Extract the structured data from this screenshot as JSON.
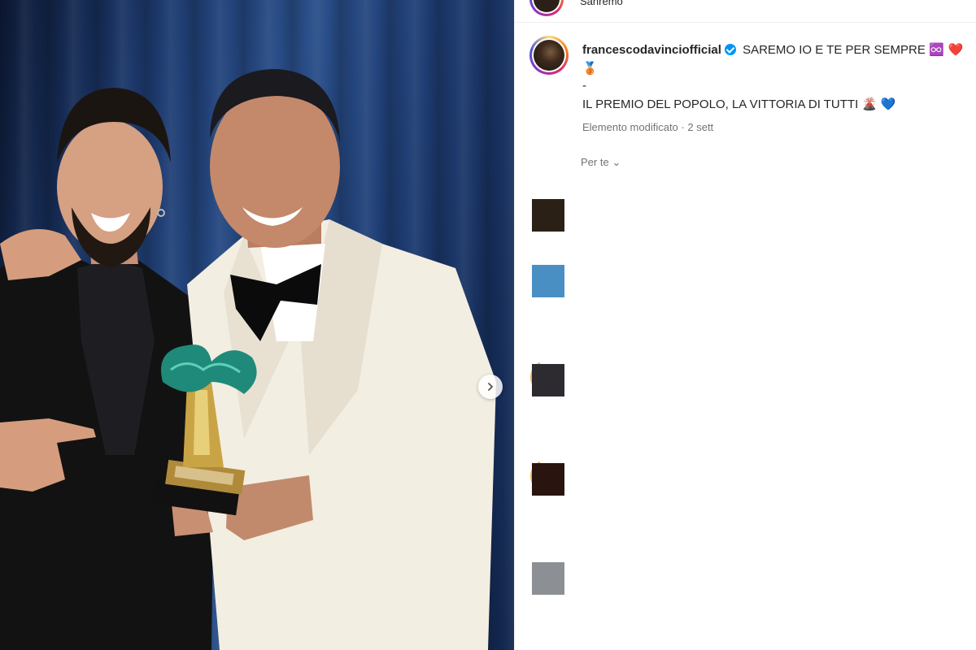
{
  "header": {
    "location": "Sanremo"
  },
  "post": {
    "username": "francescodavinciofficial",
    "caption_line1": "SAREMO IO E TE PER SEMPRE",
    "caption_line1_emojis": "♾️ ❤️",
    "caption_line2_emoji": "🥉",
    "caption_line3": "-",
    "caption_line4": "IL PREMIO DEL POPOLO, LA VITTORIA DI TUTTI",
    "caption_line4_emojis": "🌋 💙",
    "edited_label": "Elemento modificato",
    "time_ago": "2 sett",
    "translate_label": "Per te"
  },
  "colors": {
    "verified": "#0095f6",
    "meta_gray": "#737373",
    "thumb_colors": [
      "#2a2015",
      "#4a8fc4",
      "#2d2a30",
      "#2a1410",
      "#8c8f93"
    ]
  }
}
